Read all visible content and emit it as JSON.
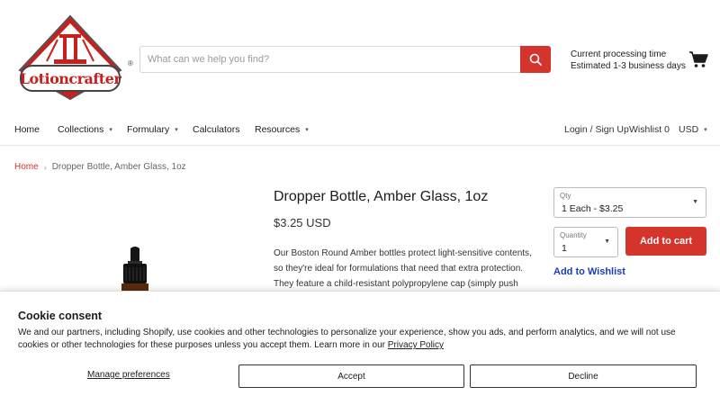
{
  "brand": {
    "logo_text": "Lotioncrafter",
    "registered": "®",
    "accent": "#d4342c"
  },
  "search": {
    "placeholder": "What can we help you find?"
  },
  "processing": {
    "line1": "Current processing time",
    "line2": "Estimated 1-3 business days"
  },
  "nav": {
    "items": [
      {
        "label": "Home"
      },
      {
        "label": "Collections",
        "dropdown": true
      },
      {
        "label": "Formulary",
        "dropdown": true
      },
      {
        "label": "Calculators"
      },
      {
        "label": "Resources",
        "dropdown": true
      }
    ],
    "login": "Login / Sign Up",
    "wishlist": "Wishlist",
    "wishlist_count": "0",
    "currency": "USD"
  },
  "breadcrumb": {
    "home": "Home",
    "current": "Dropper Bottle, Amber Glass, 1oz"
  },
  "product": {
    "title": "Dropper Bottle, Amber Glass, 1oz",
    "price": "$3.25 USD",
    "description": "Our Boston Round Amber bottles protect light-sensitive contents, so they're ideal for formulations that need that extra protection. They feature a child-resistant polypropylene cap (simply push"
  },
  "options": {
    "qty_label": "Qty",
    "qty_value": "1 Each - $3.25",
    "quantity_label": "Quantity",
    "quantity_value": "1",
    "add_to_cart": "Add to cart",
    "add_to_wishlist": "Add to Wishlist"
  },
  "consent": {
    "title": "Cookie consent",
    "body": "We and our partners, including Shopify, use cookies and other technologies to personalize your experience, show you ads, and perform analytics, and we will not use cookies or other technologies for these purposes unless you accept them. Learn more in our ",
    "policy_link": "Privacy Policy",
    "manage": "Manage preferences",
    "accept": "Accept",
    "decline": "Decline"
  }
}
